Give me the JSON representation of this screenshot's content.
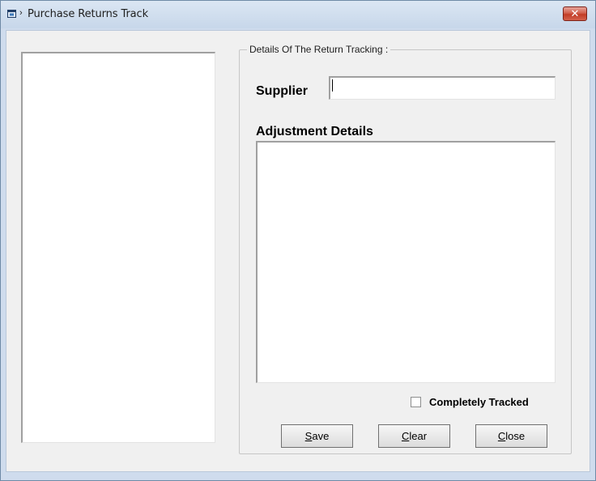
{
  "window": {
    "title": "Purchase Returns Track",
    "title_prefix": "›",
    "close_glyph": "✕"
  },
  "group": {
    "legend": "Details Of The Return Tracking :"
  },
  "supplier": {
    "label": "Supplier",
    "value": ""
  },
  "adjustment": {
    "label": "Adjustment Details",
    "value": ""
  },
  "completely_tracked": {
    "label": "Completely Tracked",
    "checked": false
  },
  "buttons": {
    "save": {
      "mnemonic": "S",
      "rest": "ave"
    },
    "clear": {
      "mnemonic": "C",
      "rest": "lear"
    },
    "close": {
      "mnemonic": "C",
      "rest": "lose"
    }
  }
}
